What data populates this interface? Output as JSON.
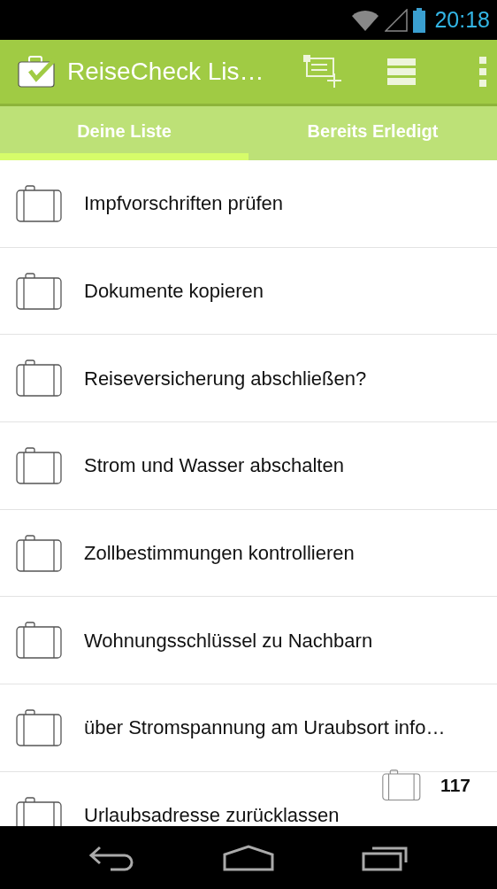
{
  "status_bar": {
    "time": "20:18"
  },
  "action_bar": {
    "title": "ReiseCheck Lis…"
  },
  "tabs": [
    {
      "label": "Deine Liste",
      "selected": true
    },
    {
      "label": "Bereits Erledigt",
      "selected": false
    }
  ],
  "items": [
    {
      "text": "Impfvorschriften prüfen"
    },
    {
      "text": "Dokumente kopieren"
    },
    {
      "text": "Reiseversicherung abschließen?"
    },
    {
      "text": "Strom und Wasser abschalten"
    },
    {
      "text": "Zollbestimmungen kontrollieren"
    },
    {
      "text": "Wohnungsschlüssel zu Nachbarn"
    },
    {
      "text": "über Stromspannung am Uraubsort info…"
    },
    {
      "text": "Urlaubsadresse zurücklassen"
    }
  ],
  "counter": {
    "count": "117"
  }
}
